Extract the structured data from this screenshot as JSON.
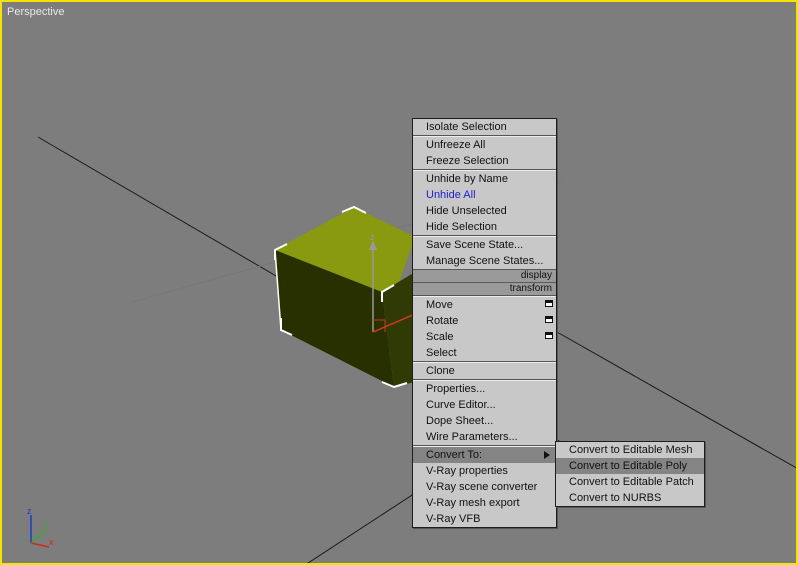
{
  "viewport": {
    "label": "Perspective"
  },
  "axis": {
    "z": "z",
    "y": "y",
    "x": "x"
  },
  "gizmo": {
    "z": "z"
  },
  "menu": {
    "isolate": "Isolate Selection",
    "unfreeze_all": "Unfreeze All",
    "freeze_selection": "Freeze Selection",
    "unhide_by_name": "Unhide by Name",
    "unhide_all": "Unhide All",
    "hide_unselected": "Hide Unselected",
    "hide_selection": "Hide Selection",
    "save_scene_state": "Save Scene State...",
    "manage_scene_states": "Manage Scene States...",
    "display_header": "display",
    "transform_header": "transform",
    "move": "Move",
    "rotate": "Rotate",
    "scale": "Scale",
    "select": "Select",
    "clone": "Clone",
    "properties": "Properties...",
    "curve_editor": "Curve Editor...",
    "dope_sheet": "Dope Sheet...",
    "wire_parameters": "Wire Parameters...",
    "convert_to": "Convert To:",
    "vray_properties": "V-Ray properties",
    "vray_scene_converter": "V-Ray scene converter",
    "vray_mesh_export": "V-Ray mesh export",
    "vray_vfb": "V-Ray VFB"
  },
  "submenu": {
    "editable_mesh": "Convert to Editable Mesh",
    "editable_poly": "Convert to Editable Poly",
    "editable_patch": "Convert to Editable Patch",
    "nurbs": "Convert to NURBS"
  },
  "colors": {
    "viewport_border": "#f5e400",
    "viewport_bg": "#7d7d7d",
    "box_top": "#8a9a10",
    "box_side": "#283000",
    "menu_bg": "#c8c8c8",
    "menu_highlight": "#848484"
  }
}
